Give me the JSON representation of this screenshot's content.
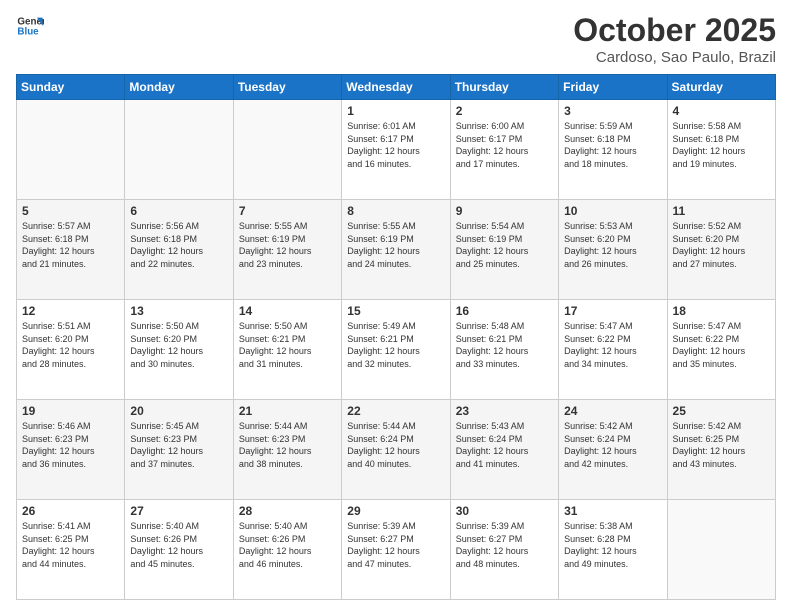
{
  "logo": {
    "line1": "General",
    "line2": "Blue"
  },
  "header": {
    "month": "October 2025",
    "location": "Cardoso, Sao Paulo, Brazil"
  },
  "weekdays": [
    "Sunday",
    "Monday",
    "Tuesday",
    "Wednesday",
    "Thursday",
    "Friday",
    "Saturday"
  ],
  "weeks": [
    [
      {
        "day": "",
        "info": ""
      },
      {
        "day": "",
        "info": ""
      },
      {
        "day": "",
        "info": ""
      },
      {
        "day": "1",
        "info": "Sunrise: 6:01 AM\nSunset: 6:17 PM\nDaylight: 12 hours\nand 16 minutes."
      },
      {
        "day": "2",
        "info": "Sunrise: 6:00 AM\nSunset: 6:17 PM\nDaylight: 12 hours\nand 17 minutes."
      },
      {
        "day": "3",
        "info": "Sunrise: 5:59 AM\nSunset: 6:18 PM\nDaylight: 12 hours\nand 18 minutes."
      },
      {
        "day": "4",
        "info": "Sunrise: 5:58 AM\nSunset: 6:18 PM\nDaylight: 12 hours\nand 19 minutes."
      }
    ],
    [
      {
        "day": "5",
        "info": "Sunrise: 5:57 AM\nSunset: 6:18 PM\nDaylight: 12 hours\nand 21 minutes."
      },
      {
        "day": "6",
        "info": "Sunrise: 5:56 AM\nSunset: 6:18 PM\nDaylight: 12 hours\nand 22 minutes."
      },
      {
        "day": "7",
        "info": "Sunrise: 5:55 AM\nSunset: 6:19 PM\nDaylight: 12 hours\nand 23 minutes."
      },
      {
        "day": "8",
        "info": "Sunrise: 5:55 AM\nSunset: 6:19 PM\nDaylight: 12 hours\nand 24 minutes."
      },
      {
        "day": "9",
        "info": "Sunrise: 5:54 AM\nSunset: 6:19 PM\nDaylight: 12 hours\nand 25 minutes."
      },
      {
        "day": "10",
        "info": "Sunrise: 5:53 AM\nSunset: 6:20 PM\nDaylight: 12 hours\nand 26 minutes."
      },
      {
        "day": "11",
        "info": "Sunrise: 5:52 AM\nSunset: 6:20 PM\nDaylight: 12 hours\nand 27 minutes."
      }
    ],
    [
      {
        "day": "12",
        "info": "Sunrise: 5:51 AM\nSunset: 6:20 PM\nDaylight: 12 hours\nand 28 minutes."
      },
      {
        "day": "13",
        "info": "Sunrise: 5:50 AM\nSunset: 6:20 PM\nDaylight: 12 hours\nand 30 minutes."
      },
      {
        "day": "14",
        "info": "Sunrise: 5:50 AM\nSunset: 6:21 PM\nDaylight: 12 hours\nand 31 minutes."
      },
      {
        "day": "15",
        "info": "Sunrise: 5:49 AM\nSunset: 6:21 PM\nDaylight: 12 hours\nand 32 minutes."
      },
      {
        "day": "16",
        "info": "Sunrise: 5:48 AM\nSunset: 6:21 PM\nDaylight: 12 hours\nand 33 minutes."
      },
      {
        "day": "17",
        "info": "Sunrise: 5:47 AM\nSunset: 6:22 PM\nDaylight: 12 hours\nand 34 minutes."
      },
      {
        "day": "18",
        "info": "Sunrise: 5:47 AM\nSunset: 6:22 PM\nDaylight: 12 hours\nand 35 minutes."
      }
    ],
    [
      {
        "day": "19",
        "info": "Sunrise: 5:46 AM\nSunset: 6:23 PM\nDaylight: 12 hours\nand 36 minutes."
      },
      {
        "day": "20",
        "info": "Sunrise: 5:45 AM\nSunset: 6:23 PM\nDaylight: 12 hours\nand 37 minutes."
      },
      {
        "day": "21",
        "info": "Sunrise: 5:44 AM\nSunset: 6:23 PM\nDaylight: 12 hours\nand 38 minutes."
      },
      {
        "day": "22",
        "info": "Sunrise: 5:44 AM\nSunset: 6:24 PM\nDaylight: 12 hours\nand 40 minutes."
      },
      {
        "day": "23",
        "info": "Sunrise: 5:43 AM\nSunset: 6:24 PM\nDaylight: 12 hours\nand 41 minutes."
      },
      {
        "day": "24",
        "info": "Sunrise: 5:42 AM\nSunset: 6:24 PM\nDaylight: 12 hours\nand 42 minutes."
      },
      {
        "day": "25",
        "info": "Sunrise: 5:42 AM\nSunset: 6:25 PM\nDaylight: 12 hours\nand 43 minutes."
      }
    ],
    [
      {
        "day": "26",
        "info": "Sunrise: 5:41 AM\nSunset: 6:25 PM\nDaylight: 12 hours\nand 44 minutes."
      },
      {
        "day": "27",
        "info": "Sunrise: 5:40 AM\nSunset: 6:26 PM\nDaylight: 12 hours\nand 45 minutes."
      },
      {
        "day": "28",
        "info": "Sunrise: 5:40 AM\nSunset: 6:26 PM\nDaylight: 12 hours\nand 46 minutes."
      },
      {
        "day": "29",
        "info": "Sunrise: 5:39 AM\nSunset: 6:27 PM\nDaylight: 12 hours\nand 47 minutes."
      },
      {
        "day": "30",
        "info": "Sunrise: 5:39 AM\nSunset: 6:27 PM\nDaylight: 12 hours\nand 48 minutes."
      },
      {
        "day": "31",
        "info": "Sunrise: 5:38 AM\nSunset: 6:28 PM\nDaylight: 12 hours\nand 49 minutes."
      },
      {
        "day": "",
        "info": ""
      }
    ]
  ]
}
